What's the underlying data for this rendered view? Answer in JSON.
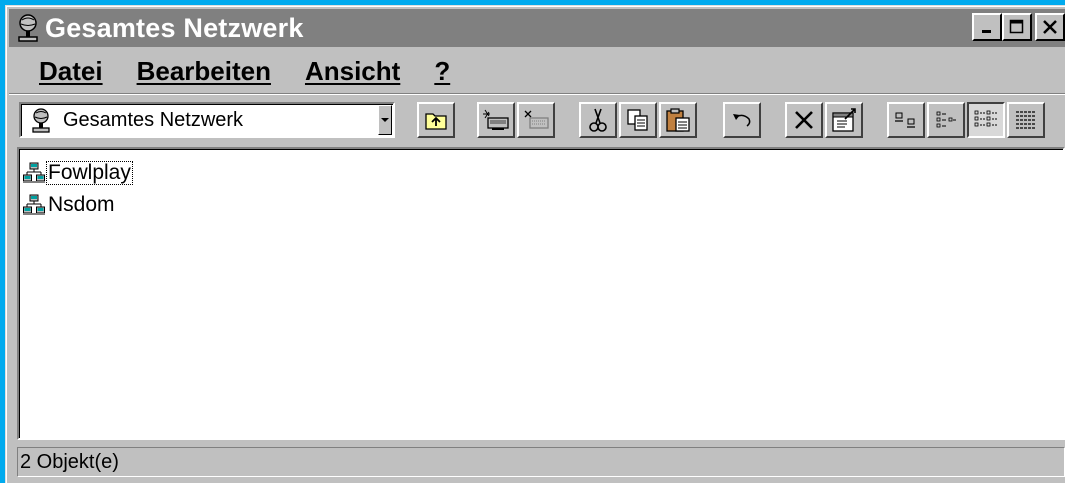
{
  "window": {
    "title": "Gesamtes Netzwerk",
    "icon": "network-neighborhood-icon",
    "caption_buttons": [
      "minimize",
      "maximize",
      "close"
    ]
  },
  "menu": [
    {
      "label": "Datei"
    },
    {
      "label": "Bearbeiten"
    },
    {
      "label": "Ansicht"
    },
    {
      "label": "?"
    }
  ],
  "toolbar": {
    "address": "Gesamtes Netzwerk",
    "buttons": [
      "up-one-level-icon",
      "map-network-drive-icon",
      "disconnect-drive-icon",
      "cut-icon",
      "copy-icon",
      "paste-icon",
      "undo-icon",
      "delete-icon",
      "properties-icon",
      "large-icons-icon",
      "small-icons-icon",
      "list-icon",
      "details-icon"
    ],
    "pressed": "list-icon"
  },
  "items": [
    {
      "label": "Fowlplay",
      "icon": "domain-icon",
      "focused": true
    },
    {
      "label": "Nsdom",
      "icon": "domain-icon",
      "focused": false
    }
  ],
  "status": {
    "text": "2 Objekt(e)"
  },
  "colors": {
    "desktop": "#00aaee",
    "titlebar_inactive": "#808080",
    "face": "#c0c0c0"
  }
}
